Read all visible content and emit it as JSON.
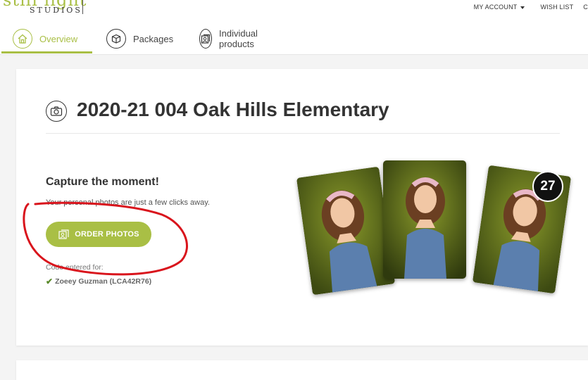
{
  "header": {
    "logo_word": "still light",
    "logo_sub": "STUDIOS",
    "my_account": "MY ACCOUNT",
    "wish_list": "WISH LIST",
    "tabs": [
      {
        "label": "Overview",
        "icon": "home-icon",
        "active": true
      },
      {
        "label": "Packages",
        "icon": "box-icon",
        "active": false
      },
      {
        "label": "Individual products",
        "icon": "photos-icon",
        "active": false
      }
    ]
  },
  "main": {
    "title": "2020-21 004 Oak Hills Elementary",
    "capture_heading": "Capture the moment!",
    "capture_sub": "Your personal photos are just a few clicks away.",
    "order_button": "ORDER PHOTOS",
    "code_label": "Code entered for:",
    "code_value": "Zoeey Guzman (LCA42R76)",
    "photo_count": "27"
  },
  "colors": {
    "accent": "#a9bf45",
    "annotation": "#d9141c"
  }
}
